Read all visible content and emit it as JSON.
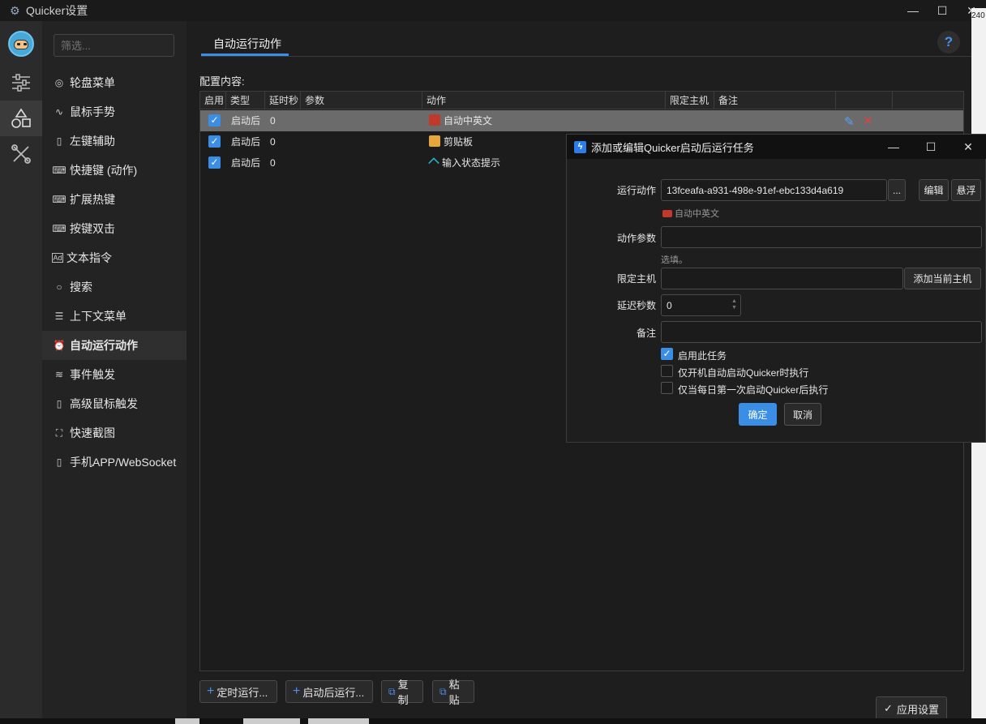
{
  "window": {
    "title": "Quicker设置"
  },
  "nav": {
    "filter_placeholder": "筛选...",
    "items": [
      {
        "label": "轮盘菜单",
        "icon": "circle-dot-icon"
      },
      {
        "label": "鼠标手势",
        "icon": "wave-icon"
      },
      {
        "label": "左键辅助",
        "icon": "mouse-icon"
      },
      {
        "label": "快捷键 (动作)",
        "icon": "keyboard-icon"
      },
      {
        "label": "扩展热键",
        "icon": "keyboard-icon"
      },
      {
        "label": "按键双击",
        "icon": "keyboard-icon"
      },
      {
        "label": "文本指令",
        "icon": "ad-icon"
      },
      {
        "label": "搜索",
        "icon": "search-icon"
      },
      {
        "label": "上下文菜单",
        "icon": "menu-icon"
      },
      {
        "label": "自动运行动作",
        "icon": "alarm-icon"
      },
      {
        "label": "事件触发",
        "icon": "wind-icon"
      },
      {
        "label": "高级鼠标触发",
        "icon": "mouse-icon"
      },
      {
        "label": "快速截图",
        "icon": "screenshot-icon"
      },
      {
        "label": "手机APP/WebSocket",
        "icon": "phone-icon"
      }
    ]
  },
  "main": {
    "tab_label": "自动运行动作",
    "help_label": "?",
    "config_label": "配置内容:",
    "columns": [
      "启用",
      "类型",
      "延时秒",
      "参数",
      "动作",
      "限定主机",
      "备注"
    ],
    "rows": [
      {
        "type": "启动后",
        "delay": "0",
        "param": "",
        "action": "自动中英文"
      },
      {
        "type": "启动后",
        "delay": "0",
        "param": "",
        "action": "剪贴板"
      },
      {
        "type": "启动后",
        "delay": "0",
        "param": "",
        "action": "输入状态提示"
      }
    ],
    "buttons": {
      "timed": "定时运行...",
      "after_start": "启动后运行...",
      "copy": "复制",
      "paste": "粘贴",
      "apply": "应用设置"
    }
  },
  "edge_text": "240",
  "dialog": {
    "title": "添加或编辑Quicker启动后运行任务",
    "labels": {
      "action": "运行动作",
      "params": "动作参数",
      "host": "限定主机",
      "delay": "延迟秒数",
      "note": "备注"
    },
    "action_id": "13fceafa-a931-498e-91ef-ebc133d4a619",
    "browse": "...",
    "edit": "编辑",
    "float": "悬浮",
    "action_name": "自动中英文",
    "params_hint": "选填。",
    "add_host": "添加当前主机",
    "delay_value": "0",
    "checks": [
      {
        "label": "启用此任务",
        "checked": true
      },
      {
        "label": "仅开机自动启动Quicker时执行",
        "checked": false
      },
      {
        "label": "仅当每日第一次启动Quicker后执行",
        "checked": false
      }
    ],
    "ok": "确定",
    "cancel": "取消"
  }
}
